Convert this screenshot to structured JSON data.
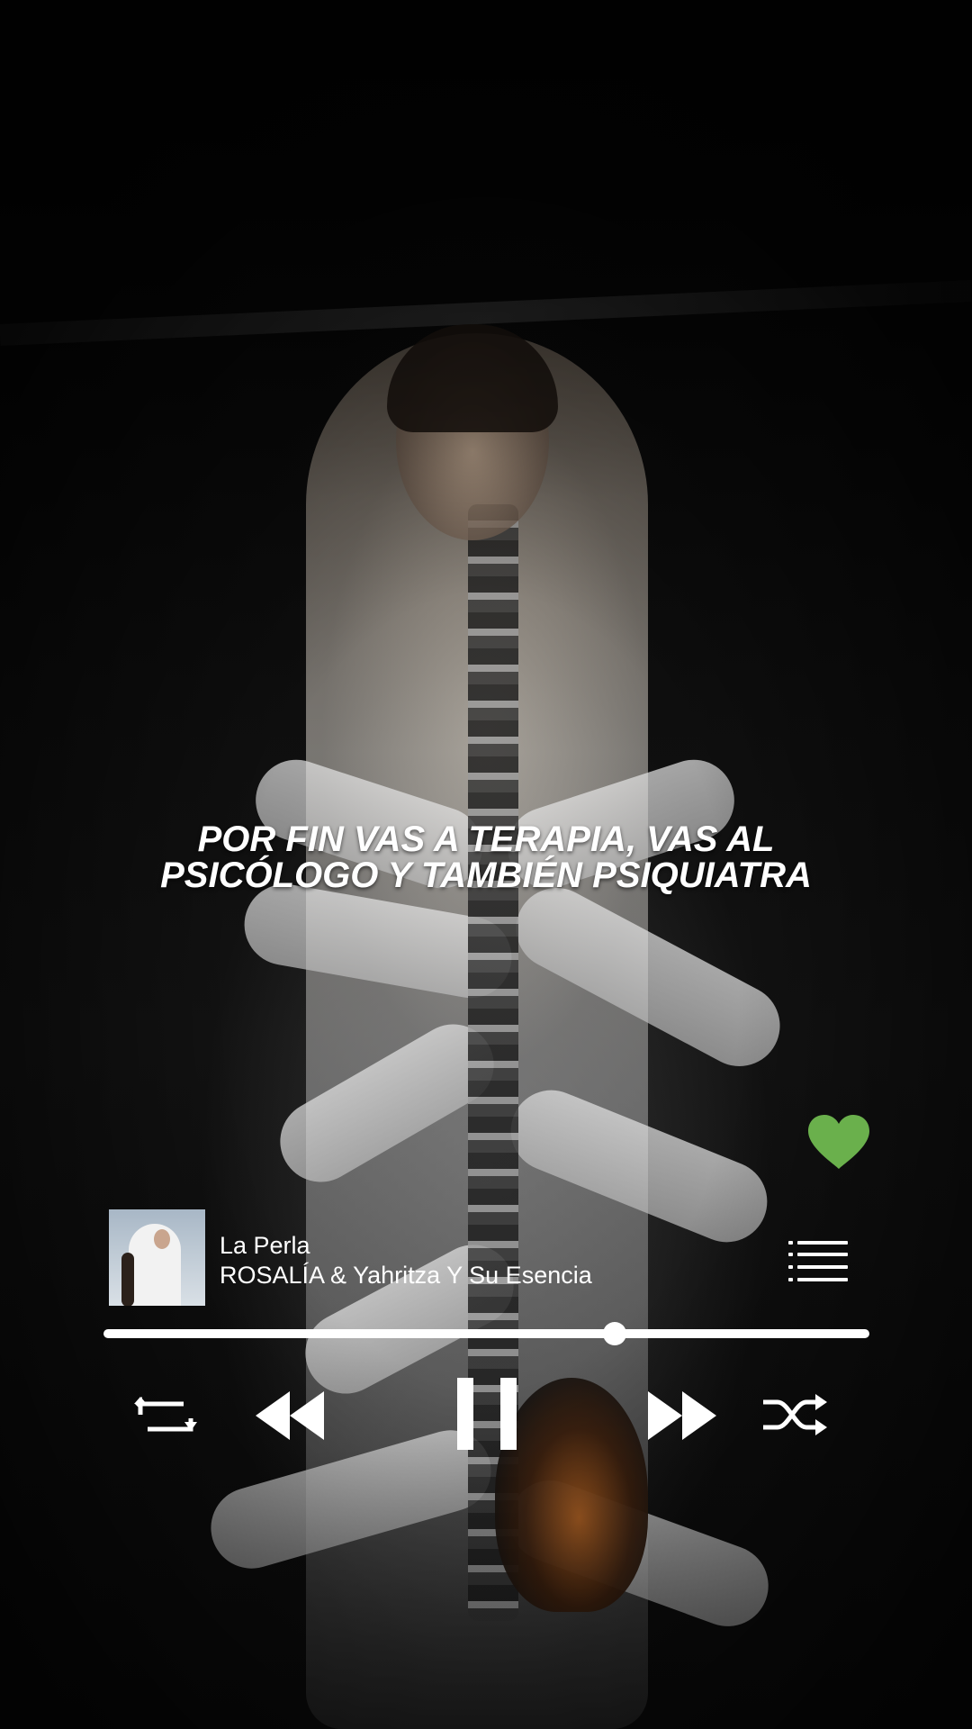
{
  "lyrics": {
    "text": "POR FIN VAS A TERAPIA, VAS AL\nPSICÓLOGO Y TAMBIÉN PSIQUIATRA"
  },
  "now_playing": {
    "title": "La Perla",
    "artist": "ROSALÍA & Yahritza Y Su Esencia",
    "liked": true,
    "progress": 0.667
  },
  "controls": {
    "repeat_icon": "repeat-icon",
    "previous_icon": "rewind-icon",
    "play_pause_icon": "pause-icon",
    "next_icon": "fast-forward-icon",
    "shuffle_icon": "shuffle-icon",
    "queue_icon": "queue-list-icon",
    "like_icon": "heart-icon"
  },
  "colors": {
    "accent": "#6ab04c",
    "foreground": "#ffffff",
    "background": "#000000"
  }
}
